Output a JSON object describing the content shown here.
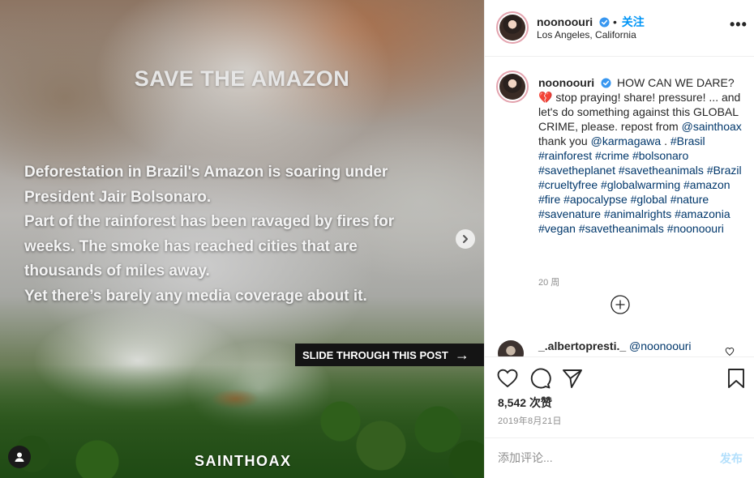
{
  "post_image": {
    "title": "SAVE THE AMAZON",
    "body_lines": [
      "Deforestation in Brazil's Amazon is soaring under",
      "President Jair Bolsonaro.",
      "Part of the rainforest has been ravaged by fires for",
      "weeks. The smoke has reached cities that are",
      "thousands of miles away.",
      "Yet there’s barely any media coverage about it."
    ],
    "slide_banner": "SLIDE THROUGH THIS POST",
    "slide_arrow": "→",
    "brand": "SAINTHOAX"
  },
  "header": {
    "username": "noonoouri",
    "follow_label": "关注",
    "location": "Los Angeles, California",
    "more_icon": "more-options-icon",
    "more_glyph": "•••"
  },
  "caption": {
    "username": "noonoouri",
    "text_start": "HOW CAN WE DARE? 💔 stop praying! share! pressure! ... and let's do something against this GLOBAL CRIME, please. repost from",
    "mention1": "@sainthoax",
    "text_mid": "thank you",
    "mention2": "@karmagawa",
    "text_end": ".",
    "hashtags": [
      "#Brasil",
      "#rainforest",
      "#crime",
      "#bolsonaro",
      "#savetheplanet",
      "#savetheanimals",
      "#Brazil",
      "#crueltyfree",
      "#globalwarming",
      "#amazon",
      "#fire",
      "#apocalypse",
      "#global",
      "#nature",
      "#savenature",
      "#animalrights",
      "#amazonia",
      "#vegan",
      "#savetheanimals",
      "#noonoouri"
    ],
    "time_ago": "20 周"
  },
  "comment": {
    "username": "_.albertopresti._",
    "mention": "@noonoouri"
  },
  "actions": {
    "likes_count": "8,542",
    "likes_label": "次赞",
    "date": "2019年8月21日"
  },
  "add_comment": {
    "placeholder": "添加评论...",
    "post_label": "发布"
  },
  "colors": {
    "accent": "#0095f6",
    "link": "#00376b",
    "muted": "#8e8e8e",
    "post_disabled": "#b2dffc",
    "border": "#efefef"
  }
}
